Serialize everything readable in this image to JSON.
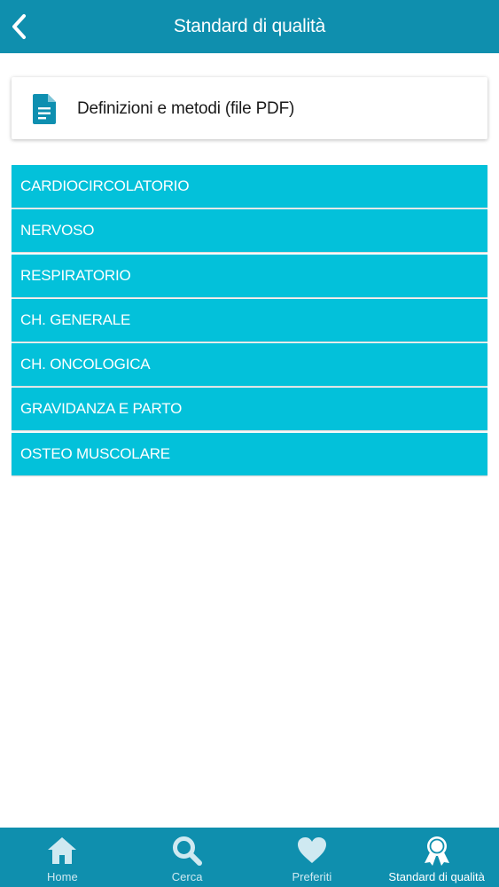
{
  "header": {
    "title": "Standard di qualità",
    "back_icon": "chevron-left-icon"
  },
  "pdf_card": {
    "icon": "document-icon",
    "label": "Definizioni e metodi (file PDF)"
  },
  "categories": [
    "CARDIOCIRCOLATORIO",
    "NERVOSO",
    "RESPIRATORIO",
    "CH. GENERALE",
    "CH. ONCOLOGICA",
    "GRAVIDANZA E PARTO",
    "OSTEO MUSCOLARE"
  ],
  "bottom_nav": [
    {
      "label": "Home",
      "icon": "home-icon",
      "active": false
    },
    {
      "label": "Cerca",
      "icon": "search-icon",
      "active": false
    },
    {
      "label": "Preferiti",
      "icon": "heart-icon",
      "active": false
    },
    {
      "label": "Standard di qualità",
      "icon": "award-ribbon-icon",
      "active": true
    }
  ],
  "colors": {
    "header_bg": "#0f8fae",
    "category_bg": "#03c1da",
    "icon_color": "#cfe9f1",
    "document_icon": "#0e8fb0"
  }
}
